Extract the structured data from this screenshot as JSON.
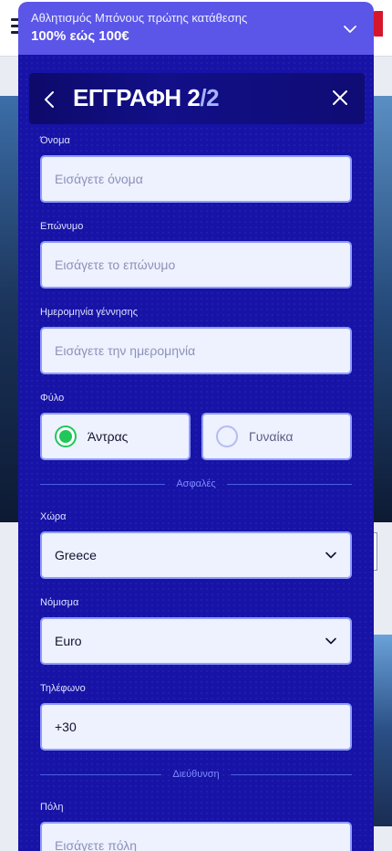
{
  "promo": {
    "line1": "Αθλητισμός Μπόνους πρώτης κατάθεσης",
    "line2": "100% εώς 100€"
  },
  "modal": {
    "title_main": "ΕΓΓΡΑΦΗ 2",
    "title_accent": "/2"
  },
  "form": {
    "first_name": {
      "label": "Όνομα",
      "placeholder": "Εισάγετε όνομα"
    },
    "last_name": {
      "label": "Επώνυμο",
      "placeholder": "Εισάγετε το επώνυμο"
    },
    "birthdate": {
      "label": "Ημερομηνία γέννησης",
      "placeholder": "Εισάγετε την ημερομηνία"
    },
    "gender": {
      "label": "Φύλο",
      "options": [
        "Άντρας",
        "Γυναίκα"
      ],
      "selected": "Άντρας"
    },
    "divider_secure": "Ασφαλές",
    "country": {
      "label": "Χώρα",
      "value": "Greece"
    },
    "currency": {
      "label": "Νόμισμα",
      "value": "Euro"
    },
    "phone": {
      "label": "Τηλέφωνο",
      "value": "+30"
    },
    "divider_address": "Διεύθυνση",
    "city": {
      "label": "Πόλη",
      "placeholder": "Εισάγετε πόλη"
    }
  },
  "colors": {
    "modal_bg": "#1713a6",
    "promo_bg": "#5b55e8",
    "accent": "#a5b4ff",
    "radio_selected": "#20c75a"
  },
  "icons": {
    "promo_toggle": "chevron-down-icon",
    "back": "chevron-left-icon",
    "close": "close-icon",
    "select": "chevron-down-icon"
  }
}
